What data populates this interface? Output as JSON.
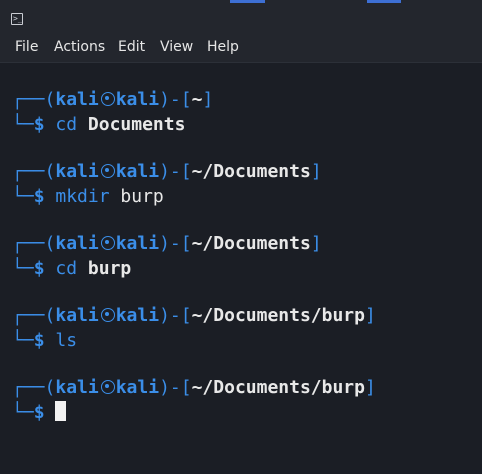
{
  "titlebar": {
    "icon": "terminal-icon"
  },
  "menu": [
    "File",
    "Actions",
    "Edit",
    "View",
    "Help"
  ],
  "prompt": {
    "user": "kali",
    "host": "kali",
    "symbol": "$"
  },
  "blocks": [
    {
      "path": "~",
      "cmd": "cd",
      "arg": "Documents"
    },
    {
      "path": "~/Documents",
      "cmd": "mkdir",
      "arg": "burp"
    },
    {
      "path": "~/Documents",
      "cmd": "cd",
      "arg": "burp"
    },
    {
      "path": "~/Documents/burp",
      "cmd": "ls",
      "arg": ""
    },
    {
      "path": "~/Documents/burp",
      "cmd": "",
      "arg": ""
    }
  ]
}
